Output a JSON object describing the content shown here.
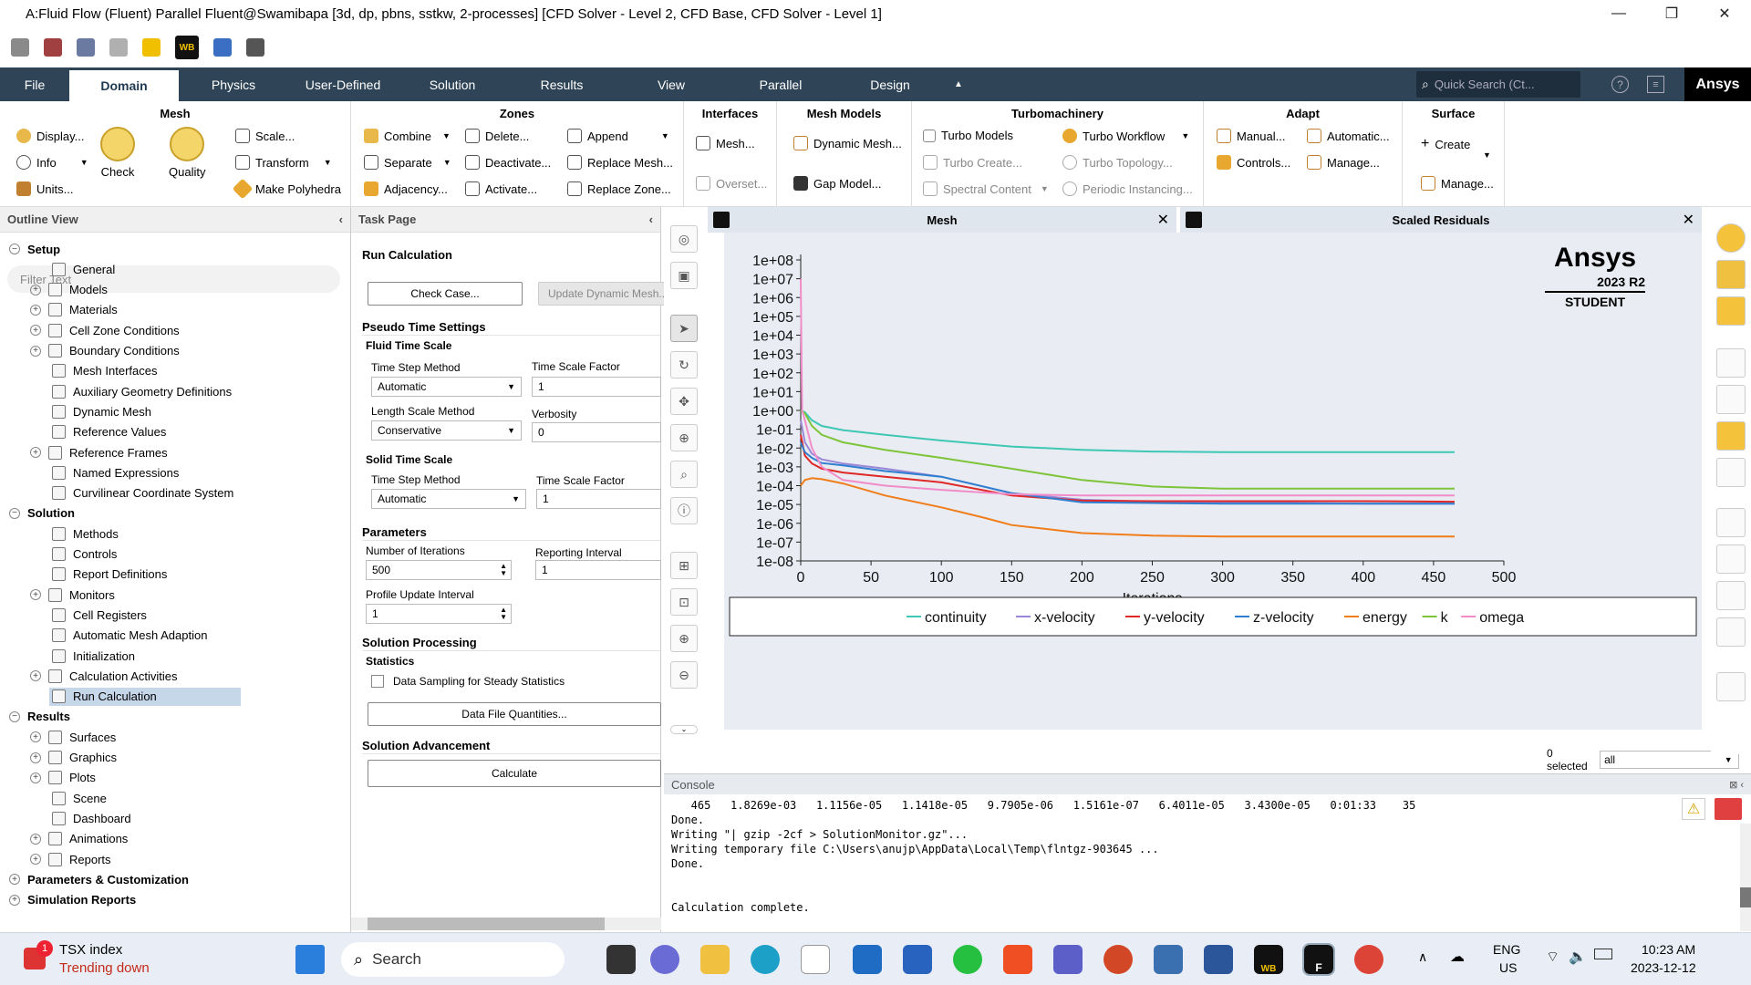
{
  "window": {
    "title": "A:Fluid Flow (Fluent) Parallel Fluent@Swamibapa  [3d, dp, pbns, sstkw, 2-processes] [CFD Solver - Level 2, CFD Base, CFD Solver - Level 1]",
    "minimize": "—",
    "restore": "❐",
    "close": "✕"
  },
  "quick_access": {
    "wb_label": "WB"
  },
  "menubar": {
    "items": [
      "File",
      "Domain",
      "Physics",
      "User-Defined",
      "Solution",
      "Results",
      "View",
      "Parallel",
      "Design"
    ],
    "active": "Domain",
    "search_placeholder": "Quick Search (Ct...",
    "brand": "Ansys"
  },
  "ribbon": {
    "mesh": {
      "title": "Mesh",
      "display": "Display...",
      "info": "Info",
      "units": "Units...",
      "check": "Check",
      "quality": "Quality",
      "scale": "Scale...",
      "transform": "Transform",
      "make_polyhedra": "Make Polyhedra"
    },
    "zones": {
      "title": "Zones",
      "combine": "Combine",
      "separate": "Separate",
      "adjacency": "Adjacency...",
      "delete": "Delete...",
      "deactivate": "Deactivate...",
      "activate": "Activate...",
      "append": "Append",
      "replace_mesh": "Replace Mesh...",
      "replace_zone": "Replace Zone..."
    },
    "interfaces": {
      "title": "Interfaces",
      "mesh": "Mesh...",
      "overset": "Overset..."
    },
    "mesh_models": {
      "title": "Mesh Models",
      "dynamic_mesh": "Dynamic Mesh...",
      "gap_model": "Gap Model..."
    },
    "turbomachinery": {
      "title": "Turbomachinery",
      "turbo_models": "Turbo Models",
      "turbo_create": "Turbo Create...",
      "spectral_content": "Spectral Content",
      "turbo_workflow": "Turbo Workflow",
      "turbo_topology": "Turbo Topology...",
      "periodic_instancing": "Periodic Instancing..."
    },
    "adapt": {
      "title": "Adapt",
      "manual": "Manual...",
      "controls": "Controls...",
      "automatic": "Automatic...",
      "manage": "Manage..."
    },
    "surface": {
      "title": "Surface",
      "create": "Create",
      "manage": "Manage..."
    }
  },
  "outline": {
    "title": "Outline View",
    "filter_placeholder": "Filter Text",
    "items": [
      {
        "label": "Setup",
        "bold": true,
        "toggle": "−",
        "level": 0
      },
      {
        "label": "General",
        "level": 2
      },
      {
        "label": "Models",
        "level": 1,
        "toggle": "+"
      },
      {
        "label": "Materials",
        "level": 1,
        "toggle": "+"
      },
      {
        "label": "Cell Zone Conditions",
        "level": 1,
        "toggle": "+"
      },
      {
        "label": "Boundary Conditions",
        "level": 1,
        "toggle": "+"
      },
      {
        "label": "Mesh Interfaces",
        "level": 2
      },
      {
        "label": "Auxiliary Geometry Definitions",
        "level": 2
      },
      {
        "label": "Dynamic Mesh",
        "level": 2
      },
      {
        "label": "Reference Values",
        "level": 2
      },
      {
        "label": "Reference Frames",
        "level": 1,
        "toggle": "+"
      },
      {
        "label": "Named Expressions",
        "level": 2
      },
      {
        "label": "Curvilinear Coordinate System",
        "level": 2
      },
      {
        "label": "Solution",
        "bold": true,
        "toggle": "−",
        "level": 0
      },
      {
        "label": "Methods",
        "level": 2
      },
      {
        "label": "Controls",
        "level": 2
      },
      {
        "label": "Report Definitions",
        "level": 2
      },
      {
        "label": "Monitors",
        "level": 1,
        "toggle": "+"
      },
      {
        "label": "Cell Registers",
        "level": 2
      },
      {
        "label": "Automatic Mesh Adaption",
        "level": 2
      },
      {
        "label": "Initialization",
        "level": 2
      },
      {
        "label": "Calculation Activities",
        "level": 1,
        "toggle": "+"
      },
      {
        "label": "Run Calculation",
        "level": 2,
        "selected": true
      },
      {
        "label": "Results",
        "bold": true,
        "toggle": "−",
        "level": 0
      },
      {
        "label": "Surfaces",
        "level": 1,
        "toggle": "+"
      },
      {
        "label": "Graphics",
        "level": 1,
        "toggle": "+"
      },
      {
        "label": "Plots",
        "level": 1,
        "toggle": "+"
      },
      {
        "label": "Scene",
        "level": 2
      },
      {
        "label": "Dashboard",
        "level": 2
      },
      {
        "label": "Animations",
        "level": 1,
        "toggle": "+"
      },
      {
        "label": "Reports",
        "level": 1,
        "toggle": "+"
      },
      {
        "label": "Parameters & Customization",
        "bold": true,
        "toggle": "+",
        "level": 0
      },
      {
        "label": "Simulation Reports",
        "bold": true,
        "toggle": "+",
        "level": 0
      }
    ]
  },
  "task": {
    "title": "Task Page",
    "heading": "Run Calculation",
    "check_case": "Check Case...",
    "update_dynamic_mesh": "Update Dynamic Mesh...",
    "pseudo_time": "Pseudo Time Settings",
    "fluid_time_scale": "Fluid Time Scale",
    "time_step_method_label": "Time Step Method",
    "time_step_method": "Automatic",
    "time_scale_factor_label": "Time Scale Factor",
    "time_scale_factor": "1",
    "length_scale_method_label": "Length Scale Method",
    "length_scale_method": "Conservative",
    "verbosity_label": "Verbosity",
    "verbosity": "0",
    "solid_time_scale": "Solid Time Scale",
    "solid_time_step_method_label": "Time Step Method",
    "solid_time_step_method": "Automatic",
    "solid_time_scale_factor_label": "Time Scale Factor",
    "solid_time_scale_factor": "1",
    "parameters": "Parameters",
    "num_iterations_label": "Number of Iterations",
    "num_iterations": "500",
    "reporting_interval_label": "Reporting Interval",
    "reporting_interval": "1",
    "profile_update_label": "Profile Update Interval",
    "profile_update": "1",
    "solution_processing": "Solution Processing",
    "statistics": "Statistics",
    "data_sampling": "Data Sampling for Steady Statistics",
    "data_file_quantities": "Data File Quantities...",
    "solution_advancement": "Solution Advancement",
    "calculate": "Calculate"
  },
  "graphics": {
    "tab_mesh": "Mesh",
    "tab_residuals": "Scaled Residuals",
    "watermark": {
      "brand": "Ansys",
      "version": "2023 R2",
      "edition": "STUDENT"
    },
    "selected_label": "0 selected",
    "selected_value": "all"
  },
  "chart_data": {
    "type": "line",
    "title": "",
    "xlabel": "Iterations",
    "ylabel": "",
    "xlim": [
      0,
      500
    ],
    "ylim": [
      1e-08,
      100000000.0
    ],
    "yscale": "log",
    "xticks": [
      0,
      50,
      100,
      150,
      200,
      250,
      300,
      350,
      400,
      450,
      500
    ],
    "yticks": [
      "1e+08",
      "1e+07",
      "1e+06",
      "1e+05",
      "1e+04",
      "1e+03",
      "1e+02",
      "1e+01",
      "1e+00",
      "1e-01",
      "1e-02",
      "1e-03",
      "1e-04",
      "1e-05",
      "1e-06",
      "1e-07",
      "1e-08"
    ],
    "grid": false,
    "legend": "bottom",
    "series": [
      {
        "name": "continuity",
        "color": "#3fc7b5",
        "x": [
          0,
          3,
          8,
          15,
          30,
          60,
          100,
          150,
          200,
          250,
          300,
          350,
          400,
          465
        ],
        "y": [
          1,
          0.8,
          0.3,
          0.15,
          0.09,
          0.05,
          0.025,
          0.012,
          0.008,
          0.0065,
          0.006,
          0.006,
          0.006,
          0.006
        ]
      },
      {
        "name": "x-velocity",
        "color": "#9b86d8",
        "x": [
          0,
          3,
          8,
          15,
          30,
          60,
          100,
          150,
          200,
          250,
          300,
          350,
          400,
          465
        ],
        "y": [
          0.3,
          0.02,
          0.005,
          0.0025,
          0.0015,
          0.0008,
          0.0003,
          4e-05,
          1.8e-05,
          1.4e-05,
          1.2e-05,
          1.2e-05,
          1.1e-05,
          1.1e-05
        ]
      },
      {
        "name": "y-velocity",
        "color": "#e02828",
        "x": [
          0,
          3,
          8,
          15,
          30,
          60,
          100,
          150,
          200,
          250,
          300,
          350,
          400,
          465
        ],
        "y": [
          0.05,
          0.004,
          0.0015,
          0.0008,
          0.0005,
          0.0003,
          0.00015,
          3e-05,
          1.6e-05,
          1.5e-05,
          1.5e-05,
          1.5e-05,
          1.5e-05,
          1.4e-05
        ]
      },
      {
        "name": "z-velocity",
        "color": "#2f7fd0",
        "x": [
          0,
          3,
          8,
          15,
          30,
          60,
          100,
          150,
          200,
          250,
          300,
          350,
          400,
          465
        ],
        "y": [
          0.02,
          0.006,
          0.003,
          0.0016,
          0.0012,
          0.0006,
          0.0003,
          4e-05,
          1.3e-05,
          1.2e-05,
          1.1e-05,
          1.1e-05,
          1.1e-05,
          1.1e-05
        ]
      },
      {
        "name": "energy",
        "color": "#f07d1a",
        "x": [
          0,
          3,
          8,
          15,
          30,
          60,
          100,
          130,
          150,
          200,
          250,
          300,
          350,
          400,
          465
        ],
        "y": [
          0.0001,
          0.0002,
          0.00025,
          0.00022,
          0.00013,
          3e-05,
          7e-06,
          2e-06,
          8e-07,
          3e-07,
          2.2e-07,
          2e-07,
          2e-07,
          2e-07,
          2e-07
        ]
      },
      {
        "name": "k",
        "color": "#7ec43a",
        "x": [
          0,
          3,
          8,
          15,
          30,
          60,
          100,
          150,
          200,
          250,
          300,
          350,
          400,
          465
        ],
        "y": [
          1,
          0.7,
          0.15,
          0.05,
          0.02,
          0.008,
          0.003,
          0.0008,
          0.0002,
          9e-05,
          7e-05,
          7e-05,
          7e-05,
          7e-05
        ]
      },
      {
        "name": "omega",
        "color": "#f28cc9",
        "x": [
          0,
          1,
          3,
          8,
          15,
          30,
          60,
          100,
          150,
          200,
          250,
          300,
          350,
          400,
          465
        ],
        "y": [
          10000000,
          1,
          0.3,
          0.01,
          0.001,
          0.0002,
          0.0001,
          6e-05,
          3.5e-05,
          3e-05,
          3e-05,
          3e-05,
          3e-05,
          3e-05,
          3e-05
        ]
      }
    ]
  },
  "console": {
    "title": "Console",
    "lines": [
      "   465   1.8269e-03   1.1156e-05   1.1418e-05   9.7905e-06   1.5161e-07   6.4011e-05   3.4300e-05   0:01:33    35",
      "Done.",
      "Writing \"| gzip -2cf > SolutionMonitor.gz\"...",
      "Writing temporary file C:\\Users\\anujp\\AppData\\Local\\Temp\\flntgz-903645 ...",
      "Done.",
      "",
      "",
      "Calculation complete."
    ]
  },
  "taskbar": {
    "news_title": "TSX index",
    "news_sub": "Trending down",
    "news_badge": "1",
    "search": "Search",
    "lang1": "ENG",
    "lang2": "US",
    "time": "10:23 AM",
    "date": "2023-12-12",
    "wb": "WB",
    "fluent": "F"
  }
}
